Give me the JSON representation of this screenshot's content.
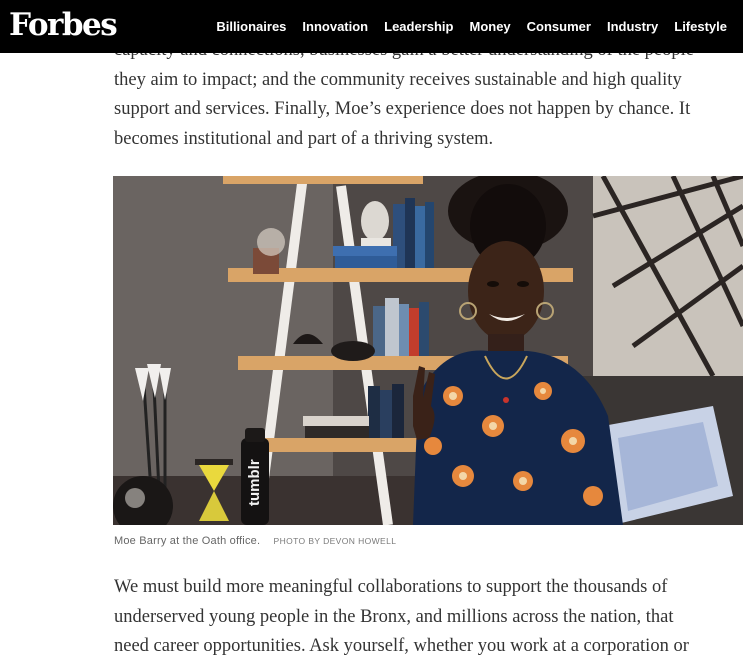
{
  "header": {
    "logo": "Forbes",
    "nav": [
      "Billionaires",
      "Innovation",
      "Leadership",
      "Money",
      "Consumer",
      "Industry",
      "Lifestyle"
    ]
  },
  "article": {
    "para_top": [
      "capacity and connections, businesses gain a better understanding of the people",
      "they aim to impact; and the community receives sustainable and high quality",
      "support and services. Finally, Moe’s experience does not happen by chance. It",
      "becomes institutional and part of a thriving system."
    ],
    "photo": {
      "caption": "Moe Barry at the Oath office.",
      "credit": "PHOTO BY DEVON HOWELL",
      "mug_text": "tumblr"
    },
    "para_bottom": [
      "We must build more meaningful collaborations to support the thousands of",
      "underserved young people in the Bronx, and millions across the nation, that",
      "need career opportunities. Ask yourself, whether you work at a corporation or"
    ]
  },
  "colors": {
    "header_bg": "#000000",
    "header_text": "#ffffff",
    "body_text": "#333333",
    "caption_text": "#666666"
  }
}
